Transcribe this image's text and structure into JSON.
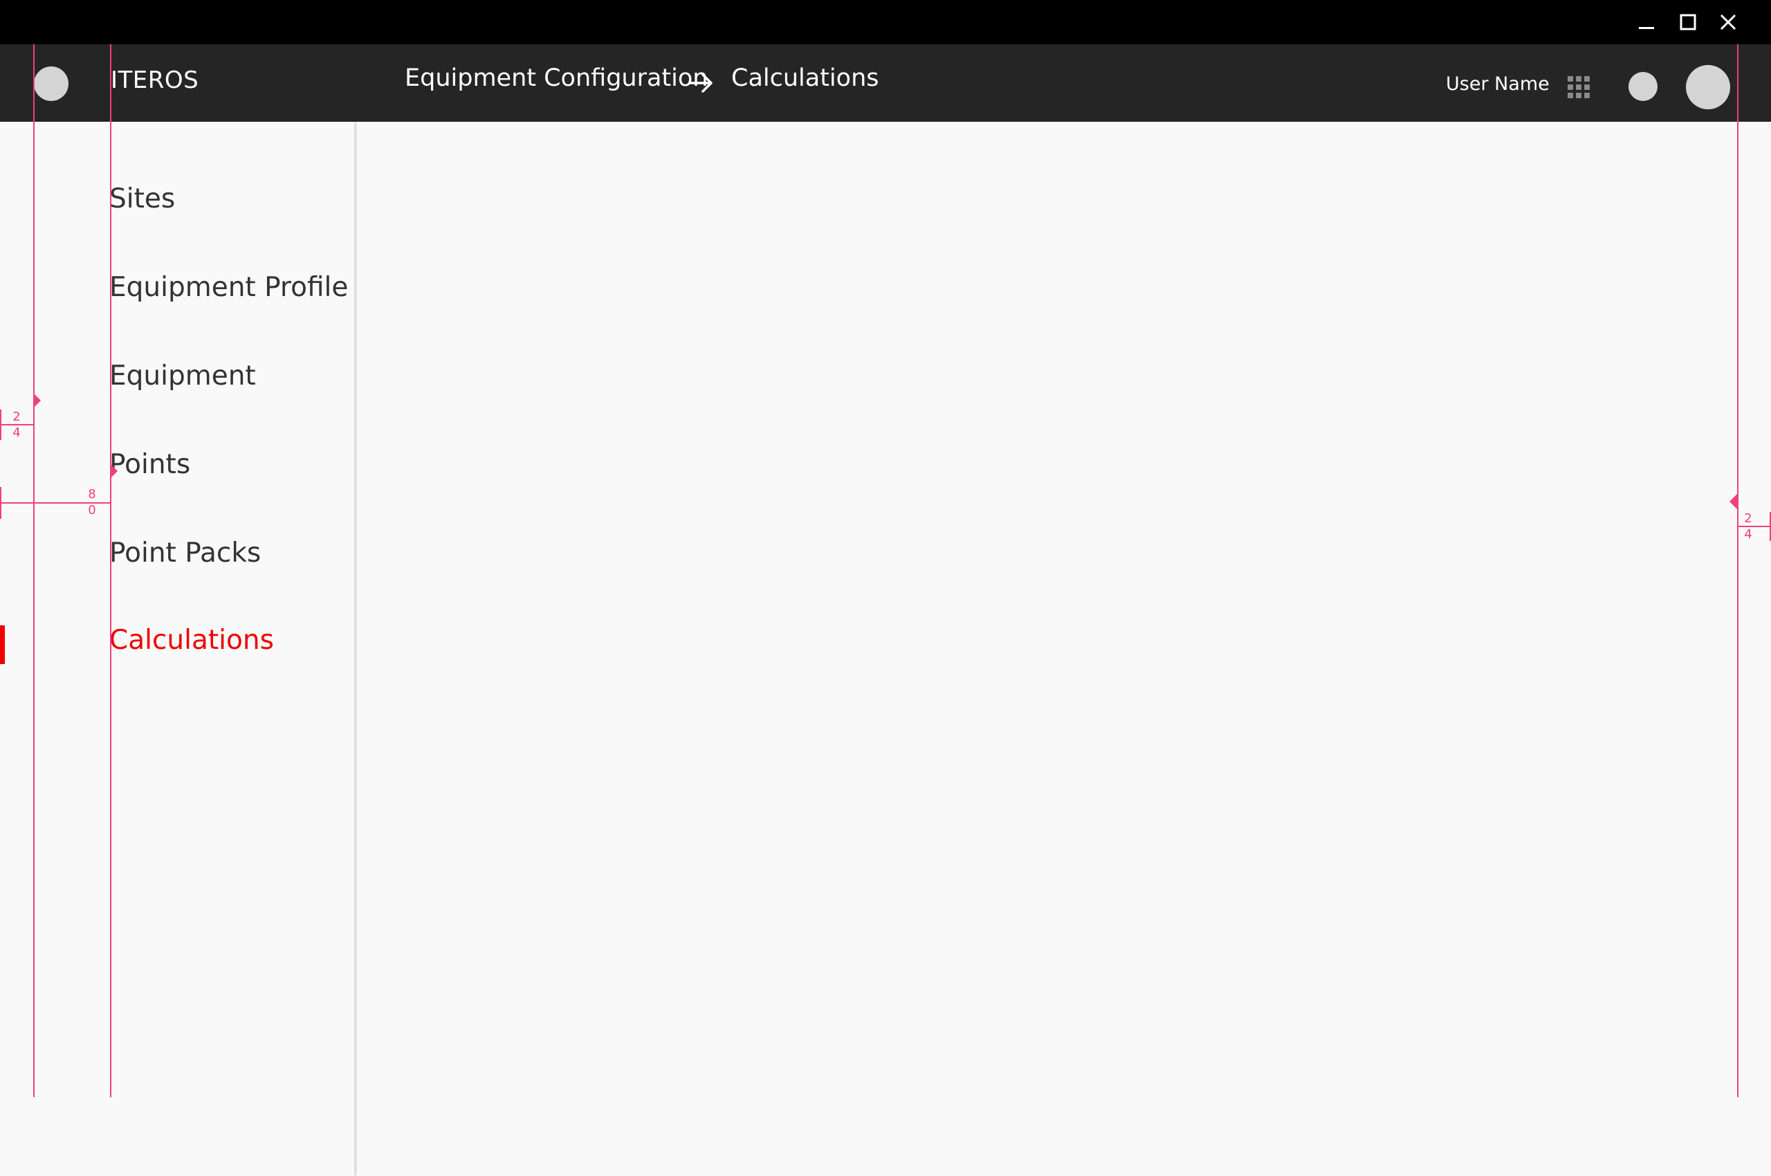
{
  "window": {
    "controls": [
      "minimize",
      "maximize",
      "close"
    ]
  },
  "header": {
    "app_name": "ITEROS",
    "breadcrumb": [
      "Equipment Configuration",
      "Calculations"
    ],
    "breadcrumb_separator_icon": "arrow-right-icon",
    "user_name": "User Name",
    "icons": [
      "apps-grid-icon",
      "status-circle",
      "avatar"
    ]
  },
  "sidebar": {
    "items": [
      {
        "label": "Sites",
        "active": false
      },
      {
        "label": "Equipment Profile",
        "active": false
      },
      {
        "label": "Equipment",
        "active": false
      },
      {
        "label": "Points",
        "active": false
      },
      {
        "label": "Point Packs",
        "active": false
      },
      {
        "label": "Calculations",
        "active": true
      }
    ]
  },
  "redlines": {
    "left_margin": "24",
    "text_inset": "80",
    "right_margin": "24"
  },
  "colors": {
    "titlebar": "#000000",
    "appbar": "#252525",
    "background": "#f9f9f9",
    "active": "#ee0000",
    "redline": "#f0407a"
  }
}
